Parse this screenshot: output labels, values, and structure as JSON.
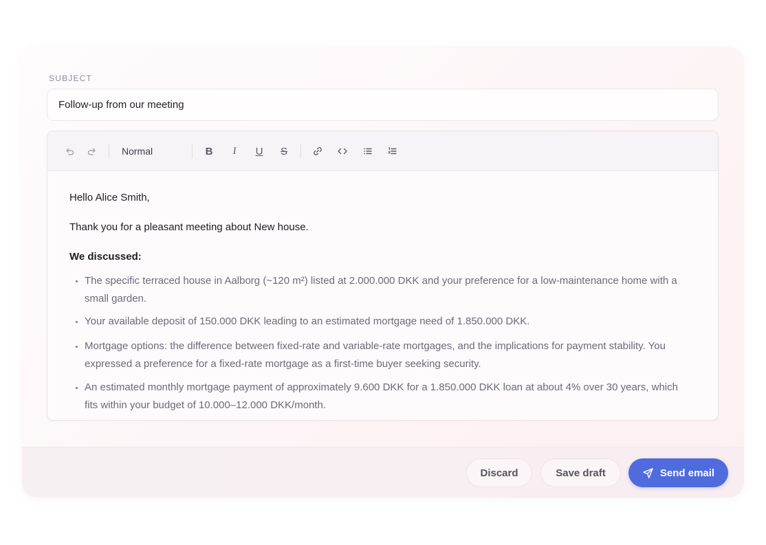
{
  "subject": {
    "label": "SUBJECT",
    "value": "Follow-up from our meeting"
  },
  "toolbar": {
    "undo_icon": "undo-icon",
    "redo_icon": "redo-icon",
    "text_style": "Normal",
    "bold_label": "B",
    "italic_label": "I",
    "underline_label": "U",
    "strike_label": "S",
    "link_icon": "link-icon",
    "code_icon": "code-icon",
    "bullet_list_icon": "bullet-list-icon",
    "numbered_list_icon": "numbered-list-icon"
  },
  "body": {
    "greeting": "Hello Alice Smith,",
    "intro": "Thank you for a pleasant meeting about New house.",
    "heading": "We discussed:",
    "bullets": [
      "The specific terraced house in Aalborg (~120 m²) listed at 2.000.000 DKK and your preference for a low-maintenance home with a small garden.",
      "Your available deposit of 150.000 DKK leading to an estimated mortgage need of 1.850.000 DKK.",
      "Mortgage options: the difference between fixed-rate and variable-rate mortgages, and the implications for payment stability. You expressed a preference for a fixed-rate mortgage as a first-time buyer seeking security.",
      "An estimated monthly mortgage payment of approximately 9.600 DKK for a 1.850.000 DKK loan at about 4% over 30 years, which fits within your budget of 10.000–12.000 DKK/month."
    ]
  },
  "footer": {
    "discard_label": "Discard",
    "save_draft_label": "Save draft",
    "send_label": "Send email",
    "send_icon": "send-icon"
  },
  "colors": {
    "accent": "#4f6bdd",
    "card_bg": "#fdf5f7",
    "text_primary": "#1d1c24",
    "text_secondary": "#6d6878"
  }
}
